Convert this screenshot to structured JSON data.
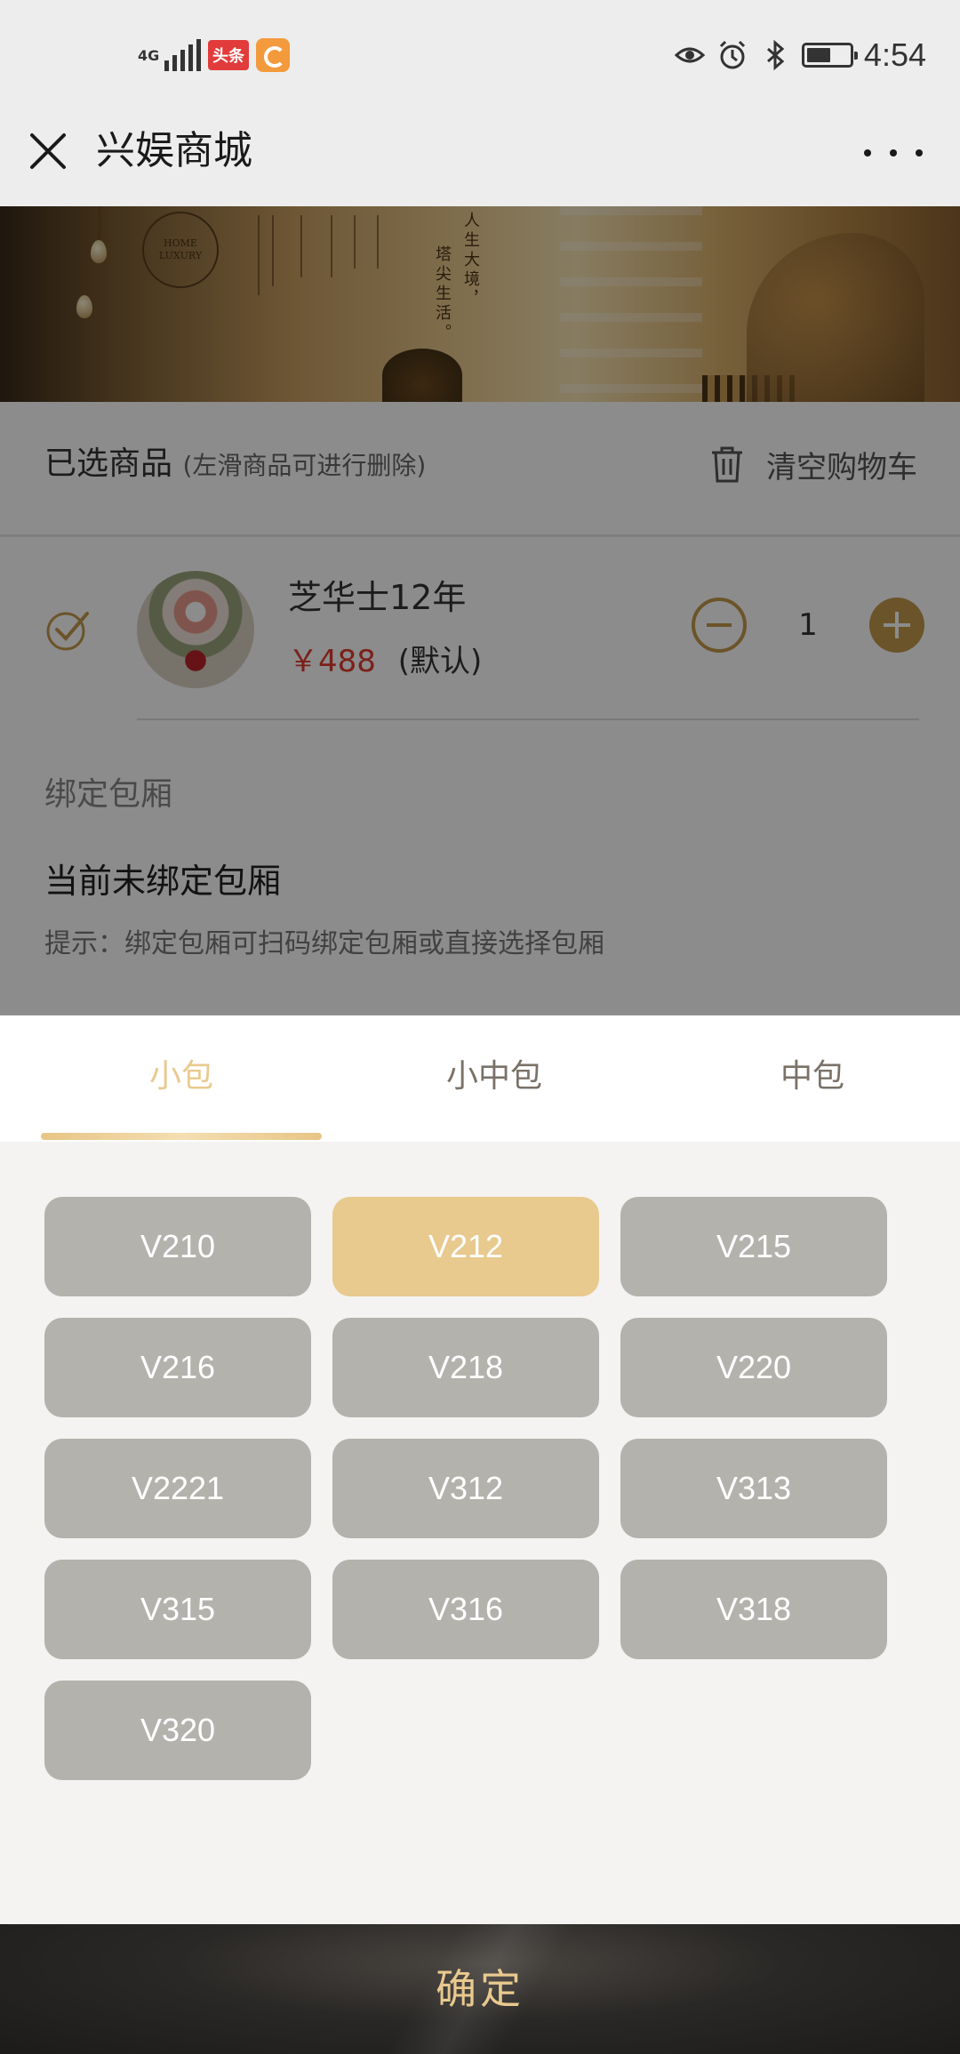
{
  "status_bar": {
    "network": "4G",
    "badge_news": "头条",
    "time": "4:54"
  },
  "header": {
    "title": "兴娱商城"
  },
  "banner": {
    "logo_text_1": "HOME",
    "logo_text_2": "LUXURY",
    "slogan_1": "人生大境，",
    "slogan_2": "塔尖生活。"
  },
  "cart": {
    "selected_label": "已选商品",
    "selected_hint": "(左滑商品可进行删除)",
    "clear_label": "清空购物车",
    "items": [
      {
        "name": "芝华士12年",
        "price": "￥488",
        "price_tag": "(默认)",
        "quantity": "1"
      }
    ]
  },
  "room": {
    "label": "绑定包厢",
    "status": "当前未绑定包厢",
    "tip": "提示：绑定包厢可扫码绑定包厢或直接选择包厢"
  },
  "picker": {
    "tabs": [
      "小包",
      "小中包",
      "中包"
    ],
    "active_tab": 0,
    "rooms": [
      "V210",
      "V212",
      "V215",
      "V216",
      "V218",
      "V220",
      "V2221",
      "V312",
      "V313",
      "V315",
      "V316",
      "V318",
      "V320"
    ],
    "selected_room": "V212"
  },
  "confirm": {
    "label": "确定"
  },
  "colors": {
    "accent": "#e8c98e",
    "price": "#e03b2e",
    "room_default": "#b3b2ad",
    "confirm_bg": "#2a2826"
  }
}
